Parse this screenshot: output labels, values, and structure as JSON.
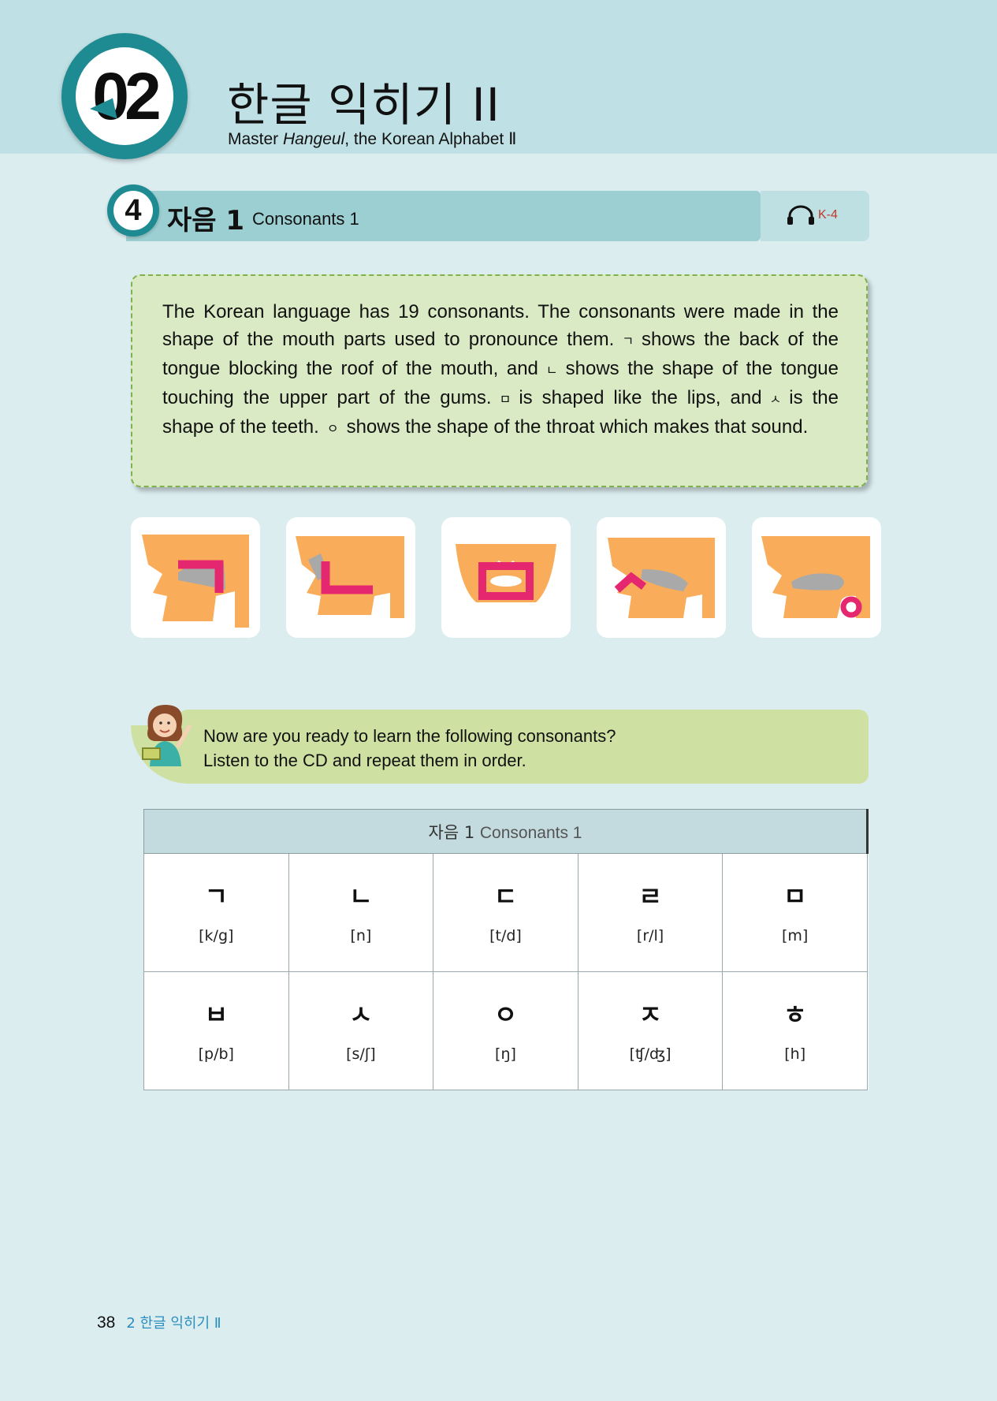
{
  "chapter": {
    "number": "02",
    "title": "한글 익히기 II",
    "subtitle_pre": "Master ",
    "subtitle_em": "Hangeul",
    "subtitle_post": ", the Korean Alphabet Ⅱ"
  },
  "section": {
    "number": "4",
    "title_ko": "자음 1",
    "title_en": "Consonants 1",
    "audio_track": "K-4"
  },
  "intro": {
    "p1": "The Korean language has 19 consonants. The consonants were made in the shape of the mouth parts used to pronounce them.",
    "j1": "ㄱ",
    "p2": "shows the back of the tongue blocking the roof of the mouth, and",
    "j2": "ㄴ",
    "p3": "shows the shape of the tongue touching the upper part of the gums.",
    "j3": "ㅁ",
    "p4": "is shaped like the lips, and",
    "j4": "ㅅ",
    "p5": "is the shape of the teeth.",
    "j5": "ㅇ",
    "p6": "shows the shape of the throat which makes that sound."
  },
  "helper": {
    "line1": "Now are you ready to learn the following consonants?",
    "line2": "Listen to the CD and repeat them in order."
  },
  "table": {
    "header_ko": "자음 1",
    "header_en": "Consonants 1",
    "cells": [
      {
        "c": "ㄱ",
        "ipa": "[k/g]"
      },
      {
        "c": "ㄴ",
        "ipa": "[n]"
      },
      {
        "c": "ㄷ",
        "ipa": "[t/d]"
      },
      {
        "c": "ㄹ",
        "ipa": "[r/l]"
      },
      {
        "c": "ㅁ",
        "ipa": "[m]"
      },
      {
        "c": "ㅂ",
        "ipa": "[p/b]"
      },
      {
        "c": "ㅅ",
        "ipa": "[s/ʃ]"
      },
      {
        "c": "ㅇ",
        "ipa": "[ŋ]"
      },
      {
        "c": "ㅈ",
        "ipa": "[ʧ/ʤ]"
      },
      {
        "c": "ㅎ",
        "ipa": "[h]"
      }
    ]
  },
  "footer": {
    "page": "38",
    "running_title": "2 한글 익히기 Ⅱ"
  },
  "colors": {
    "accent_teal": "#1e8a92",
    "highlight_pink": "#e5276f",
    "mouth_orange": "#f9ad5a"
  }
}
